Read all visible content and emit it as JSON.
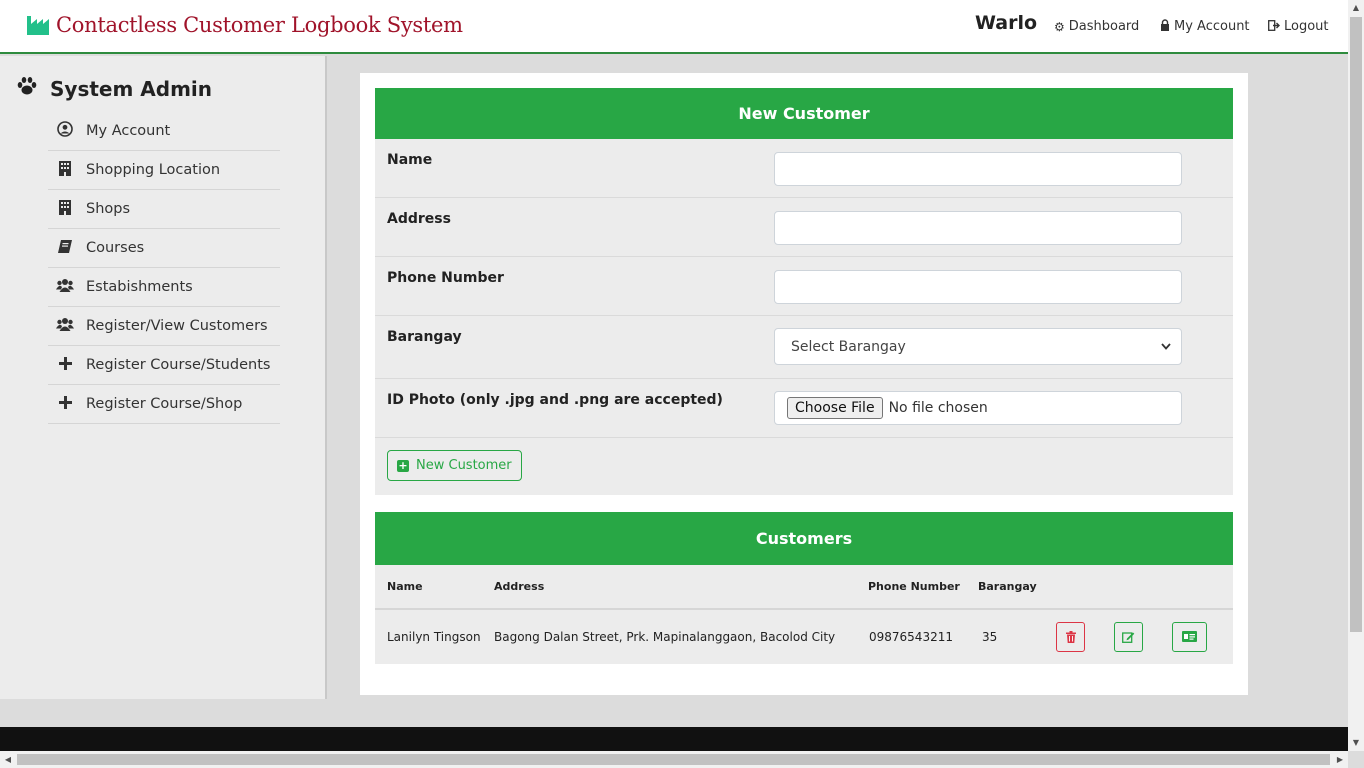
{
  "header": {
    "brand": "Contactless Customer Logbook System",
    "brand_icon": "factory-icon",
    "user": "Warlo",
    "links": [
      {
        "label": "Dashboard",
        "icon": "gear-icon"
      },
      {
        "label": "My Account",
        "icon": "lock-icon"
      },
      {
        "label": "Logout",
        "icon": "sign-out-icon"
      }
    ]
  },
  "sidebar": {
    "title": "System Admin",
    "title_icon": "paw-icon",
    "items": [
      {
        "label": "My Account",
        "icon": "user-circle-icon"
      },
      {
        "label": "Shopping Location",
        "icon": "building-icon"
      },
      {
        "label": "Shops",
        "icon": "building-icon"
      },
      {
        "label": "Courses",
        "icon": "book-icon"
      },
      {
        "label": "Estabishments",
        "icon": "users-icon"
      },
      {
        "label": "Register/View Customers",
        "icon": "users-icon"
      },
      {
        "label": "Register Course/Students",
        "icon": "plus-icon"
      },
      {
        "label": "Register Course/Shop",
        "icon": "plus-icon"
      }
    ]
  },
  "new_customer": {
    "title": "New Customer",
    "name_label": "Name",
    "name_value": "",
    "address_label": "Address",
    "address_value": "",
    "phone_label": "Phone Number",
    "phone_value": "",
    "barangay_label": "Barangay",
    "barangay_selected": "Select Barangay",
    "photo_label": "ID Photo (only .jpg and .png are accepted)",
    "file_button": "Choose File",
    "file_status": "No file chosen",
    "submit_label": "New Customer"
  },
  "customers": {
    "title": "Customers",
    "columns": [
      "Name",
      "Address",
      "Phone Number",
      "Barangay"
    ],
    "rows": [
      {
        "name": "Lanilyn Tingson",
        "address": "Bagong Dalan Street, Prk. Mapinalanggaon, Bacolod City",
        "phone": "09876543211",
        "barangay": "35"
      }
    ]
  },
  "colors": {
    "accent": "#28a745",
    "brand": "#a0132a",
    "danger": "#dc3545"
  }
}
